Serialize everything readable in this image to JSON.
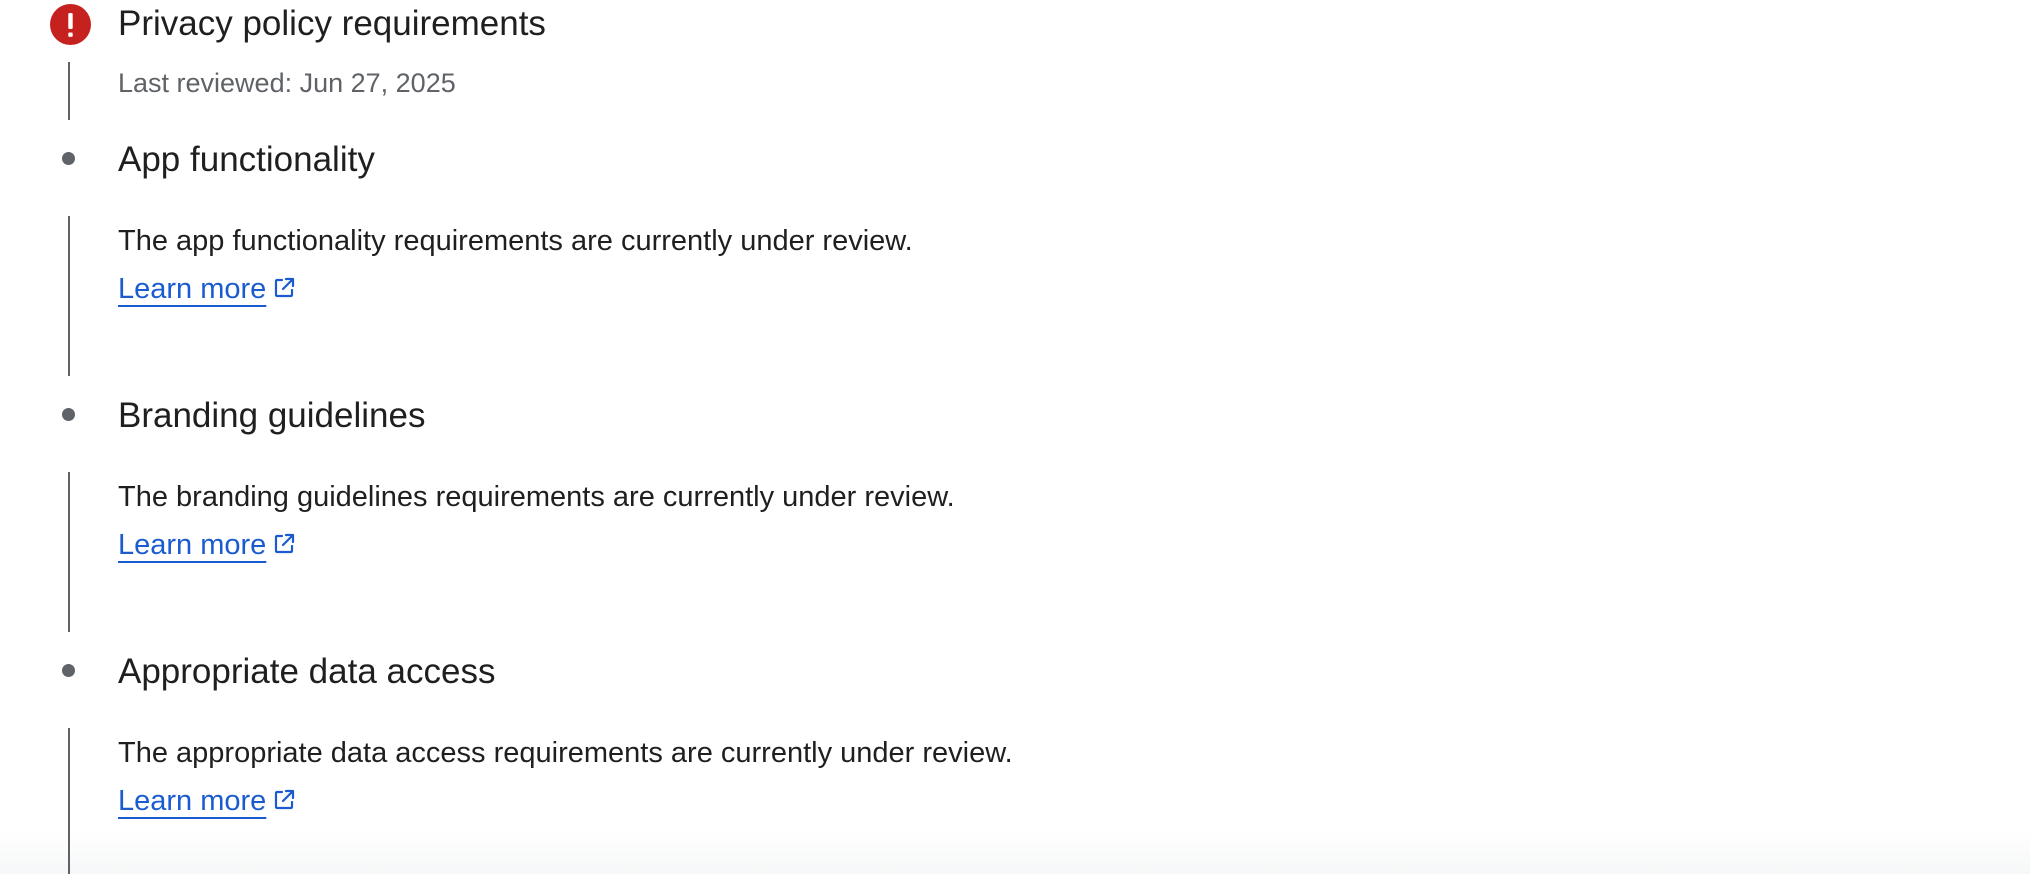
{
  "colors": {
    "error": "#c5221f",
    "link": "#1a5ccf",
    "timeline": "#5f6368",
    "text": "#1f1f1f",
    "meta": "#5f6368"
  },
  "steps": [
    {
      "status_icon": "error-icon",
      "title": "Privacy policy requirements",
      "meta": "Last reviewed: Jun 27, 2025"
    },
    {
      "status_icon": "bullet-dot",
      "title": "App functionality",
      "description": "The app functionality requirements are currently under review.",
      "link_label": "Learn more",
      "link_icon": "open-in-new-icon"
    },
    {
      "status_icon": "bullet-dot",
      "title": "Branding guidelines",
      "description": "The branding guidelines requirements are currently under review.",
      "link_label": "Learn more",
      "link_icon": "open-in-new-icon"
    },
    {
      "status_icon": "bullet-dot",
      "title": "Appropriate data access",
      "description": "The appropriate data access requirements are currently under review.",
      "link_label": "Learn more",
      "link_icon": "open-in-new-icon"
    }
  ]
}
